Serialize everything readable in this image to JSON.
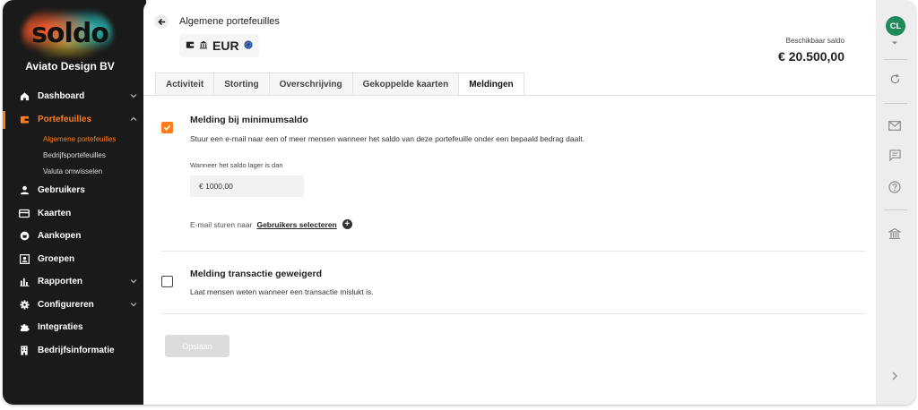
{
  "sidebar": {
    "logo_text": "soldo",
    "company": "Aviato Design BV",
    "items": [
      {
        "label": "Dashboard",
        "icon": "home-icon",
        "has_chevron": true
      },
      {
        "label": "Portefeuilles",
        "icon": "wallet-icon",
        "has_chevron": true,
        "active": true
      },
      {
        "label": "Gebruikers",
        "icon": "user-icon"
      },
      {
        "label": "Kaarten",
        "icon": "card-icon"
      },
      {
        "label": "Aankopen",
        "icon": "shopping-icon"
      },
      {
        "label": "Groepen",
        "icon": "group-icon"
      },
      {
        "label": "Rapporten",
        "icon": "chart-icon",
        "has_chevron": true
      },
      {
        "label": "Configureren",
        "icon": "gear-icon",
        "has_chevron": true
      },
      {
        "label": "Integraties",
        "icon": "puzzle-icon"
      },
      {
        "label": "Bedrijfsinformatie",
        "icon": "building-icon"
      }
    ],
    "subitems": [
      {
        "label": "Algemene portefeuilles",
        "active": true
      },
      {
        "label": "Bedrijfsportefeuilles"
      },
      {
        "label": "Valuta omwisselen"
      }
    ]
  },
  "header": {
    "breadcrumb": "Algemene portefeuilles",
    "currency_code": "EUR",
    "balance_label": "Beschikbaar saldo",
    "balance_value": "€ 20.500,00"
  },
  "tabs": [
    {
      "label": "Activiteit"
    },
    {
      "label": "Storting"
    },
    {
      "label": "Overschrijving"
    },
    {
      "label": "Gekoppelde kaarten"
    },
    {
      "label": "Meldingen",
      "active": true
    }
  ],
  "sections": {
    "min_balance": {
      "title": "Melding bij minimumsaldo",
      "description": "Stuur een e-mail naar een of meer mensen wanneer het saldo van deze portefeuille onder een bepaald bedrag daalt.",
      "checked": true,
      "field_label": "Wanneer het saldo lager is dan",
      "field_value": "€ 1000,00",
      "email_prefix": "E-mail sturen naar",
      "email_link": "Gebruikers selecteren"
    },
    "declined": {
      "title": "Melding transactie geweigerd",
      "description": "Laat mensen weten wanneer een transactie mislukt is.",
      "checked": false
    }
  },
  "save_label": "Opslaan",
  "rail": {
    "avatar_initials": "CL"
  },
  "colors": {
    "accent": "#ff7a1a",
    "sidebar_bg": "#1a1a1a",
    "avatar_bg": "#1e8a5a"
  }
}
